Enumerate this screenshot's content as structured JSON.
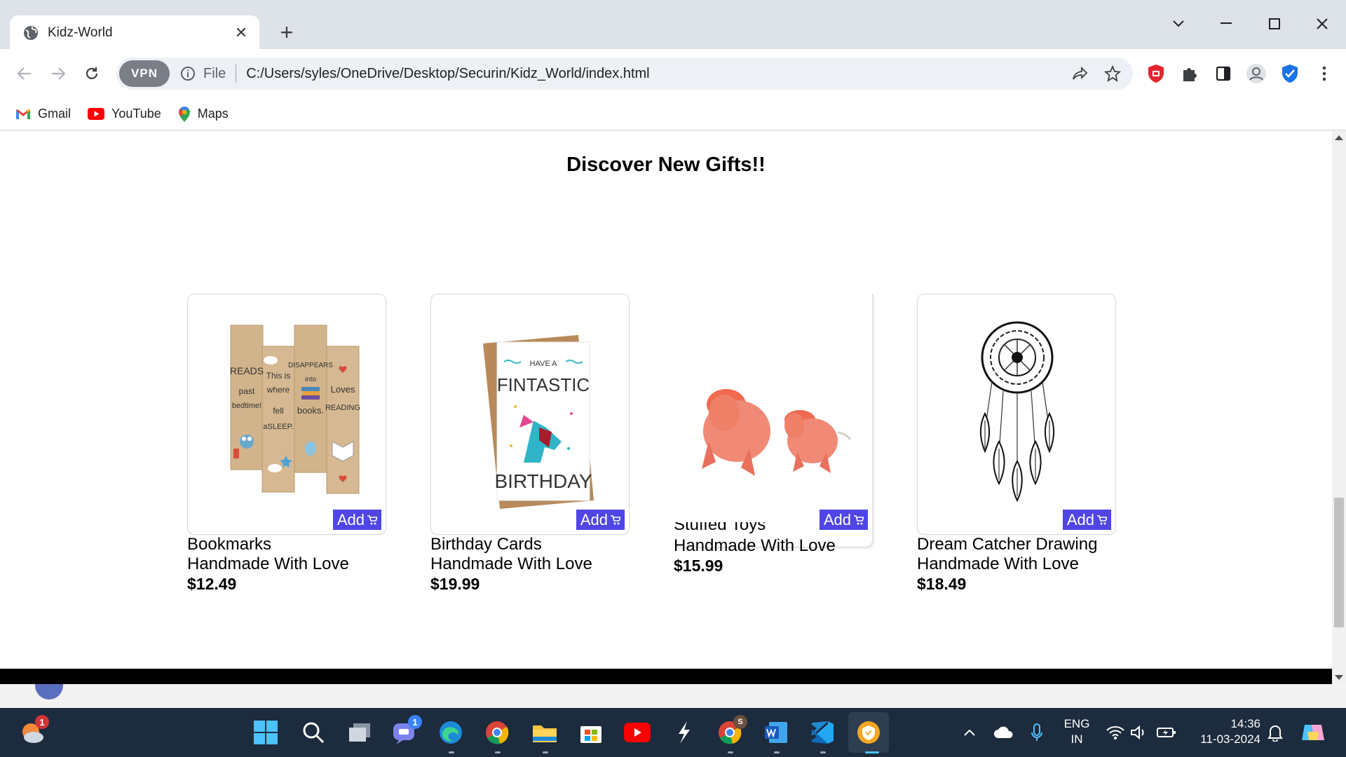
{
  "browser": {
    "tab_title": "Kidz-World",
    "new_tab": "+",
    "vpn_label": "VPN",
    "file_label": "File",
    "url": "C:/Users/syles/OneDrive/Desktop/Securin/Kidz_World/index.html",
    "bookmarks": [
      {
        "label": "Gmail",
        "icon": "gmail-icon"
      },
      {
        "label": "YouTube",
        "icon": "youtube-icon"
      },
      {
        "label": "Maps",
        "icon": "maps-icon"
      }
    ]
  },
  "page": {
    "title": "Discover New Gifts!!",
    "add_label": "Add",
    "products": [
      {
        "name": "Bookmarks",
        "tagline": "Handmade With Love",
        "price": "$12.49",
        "image": "bookmarks-image"
      },
      {
        "name": "Birthday Cards",
        "tagline": "Handmade With Love",
        "price": "$19.99",
        "image": "birthday-card-image"
      },
      {
        "name": "Stuffed Toys",
        "tagline": "Handmade With Love",
        "price": "$15.99",
        "image": "stuffed-toys-image"
      },
      {
        "name": "Dream Catcher Drawing",
        "tagline": "Handmade With Love",
        "price": "$18.49",
        "image": "dream-catcher-image"
      }
    ],
    "bookmark_texts": [
      "READS",
      "past",
      "bedtime!",
      "This is",
      "where",
      "fell",
      "aSLEEP.",
      "DISAPPEARS",
      "into",
      "books.",
      "Loves",
      "READING"
    ],
    "card_texts": [
      "HAVE A",
      "FINTASTIC",
      "BIRTHDAY"
    ]
  },
  "taskbar": {
    "language": "ENG",
    "region": "IN",
    "time": "14:36",
    "date": "11-03-2024",
    "weather_badge": "1",
    "teams_badge": "1",
    "chrome_profile_badge": "S"
  },
  "colors": {
    "accent": "#4f46e5",
    "taskbar": "#1c2b3d",
    "tabstrip": "#dee3e9"
  }
}
